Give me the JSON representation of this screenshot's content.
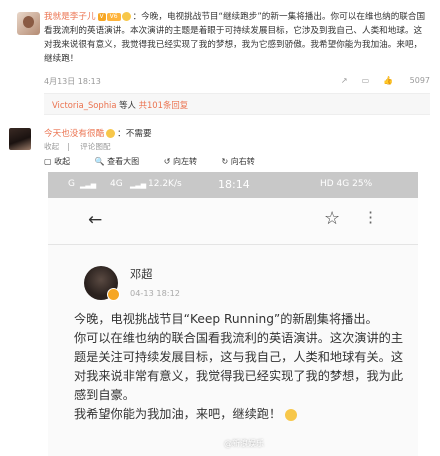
{
  "comment1": {
    "author": "我就是李子儿",
    "level": "V6",
    "text": "：今晚，电视挑战节目“继续跑步”的新一集将播出。你可以在维也纳的联合国看我流利的英语演讲。本次演讲的主题是着眼于可持续发展目标，它涉及到我自己、人类和地球。这对我来说很有意义，我觉得我已经实现了我的梦想，我为它感到骄傲。我希望你能为我加油。来吧，继续跑！",
    "time": "4月13日 18:13",
    "like_count": "5097"
  },
  "replies": {
    "user": "Victoria_Sophia",
    "middle": " 等人 ",
    "count": "共101条回复"
  },
  "comment2": {
    "author": "今天也没有很酷",
    "text": "：不需要",
    "actions": [
      "收起",
      "查看大图",
      "向左转",
      "向右转"
    ],
    "acts_prefix": "收起",
    "acts_sep": "|",
    "acts_orig": "评论图配"
  },
  "screenshot": {
    "status_left": "G",
    "status_network": "4G",
    "status_speed": "12.2K/s",
    "status_time": "18:14",
    "status_right": "HD 4G  25%",
    "poster_name": "邓超",
    "poster_time": "04-13 18:12",
    "body": [
      "今晚，电视挑战节目“Keep Running”的新剧集将播出。",
      "你可以在维也纳的联合国看我流利的英语演讲。这次演讲的主题是关注可持续发展目标，这与我自己，人类和地球有关。这对我来说非常有意义，我觉得我已经实现了我的梦想，我为此感到自豪。",
      "我希望你能为我加油，来吧，继续跑！"
    ],
    "watermark": "@新浪娱乐"
  },
  "colors": {
    "accent": "#eb7350",
    "gold": "#f6a623"
  }
}
